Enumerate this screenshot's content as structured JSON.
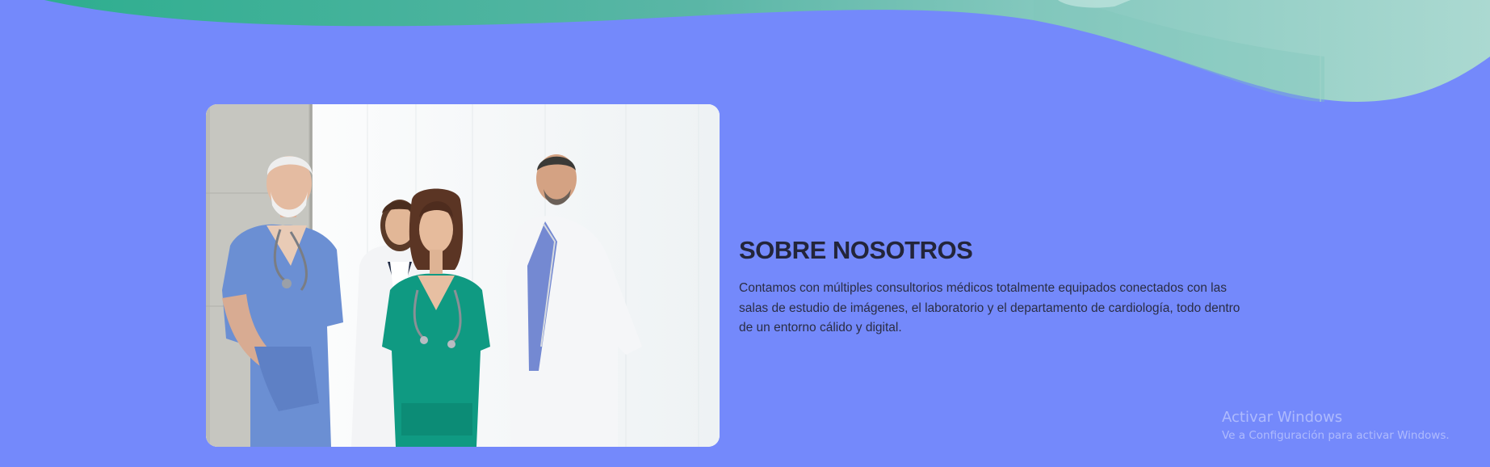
{
  "about": {
    "title": "SOBRE NOSOTROS",
    "description": "Contamos con múltiples consultorios médicos totalmente equipados conectados con las salas de estudio de imágenes, el laboratorio y el departamento de cardiología, todo dentro de un entorno cálido y digital."
  },
  "photo": {
    "alt": "Equipo médico"
  },
  "watermark": {
    "title": "Activar Windows",
    "subtitle": "Ve a Configuración para activar Windows."
  },
  "colors": {
    "background": "#7489fb",
    "wave_teal": "#3fb198",
    "wave_light": "#a9d8d0",
    "heading": "#23253a"
  }
}
